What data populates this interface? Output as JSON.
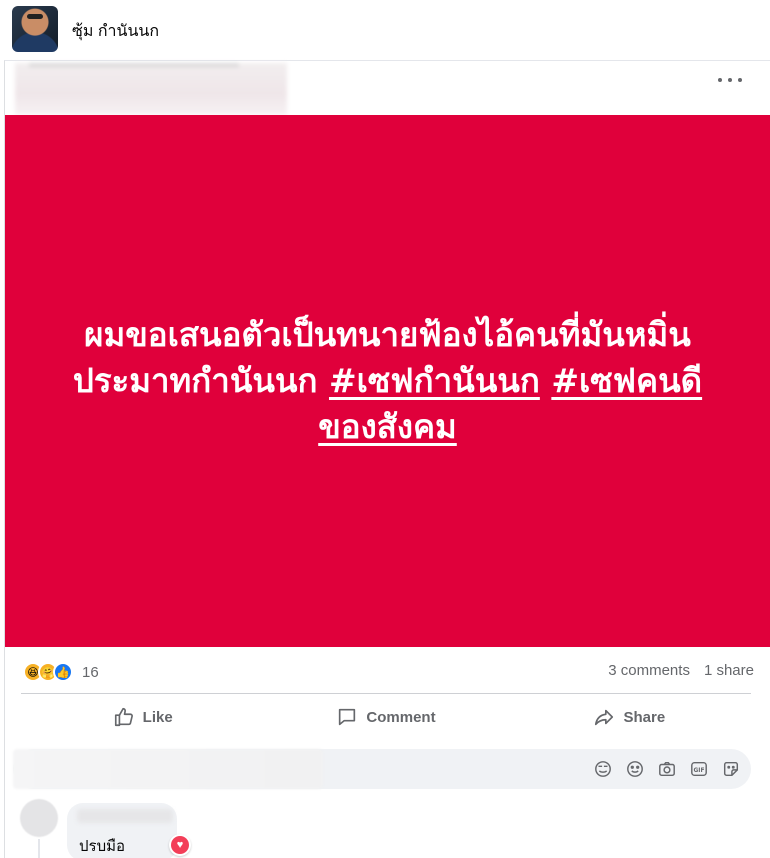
{
  "topbar": {
    "name": "ซุ้ม กำนันนก"
  },
  "post": {
    "text_plain": "ผมขอเสนอตัวเป็นทนายฟ้องไอ้คนที่มันหมิ่นประมาทกำนันนก",
    "hashtag1": "#เซฟกำนันนก",
    "hashtag2": "#เซฟคนดีของสังคม",
    "background_color": "#e0003b"
  },
  "stats": {
    "reaction_count": "16",
    "comments": "3 comments",
    "shares": "1 share",
    "reaction_icons": [
      "haha-icon",
      "care-icon",
      "like-icon"
    ]
  },
  "actions": {
    "like": "Like",
    "comment": "Comment",
    "share": "Share"
  },
  "comment_bar": {
    "icons": [
      "sticker-face-icon",
      "emoji-icon",
      "camera-icon",
      "gif-icon",
      "sticker-icon"
    ]
  },
  "comments": [
    {
      "text": "ปรบมือ",
      "reaction": "love-icon"
    }
  ]
}
